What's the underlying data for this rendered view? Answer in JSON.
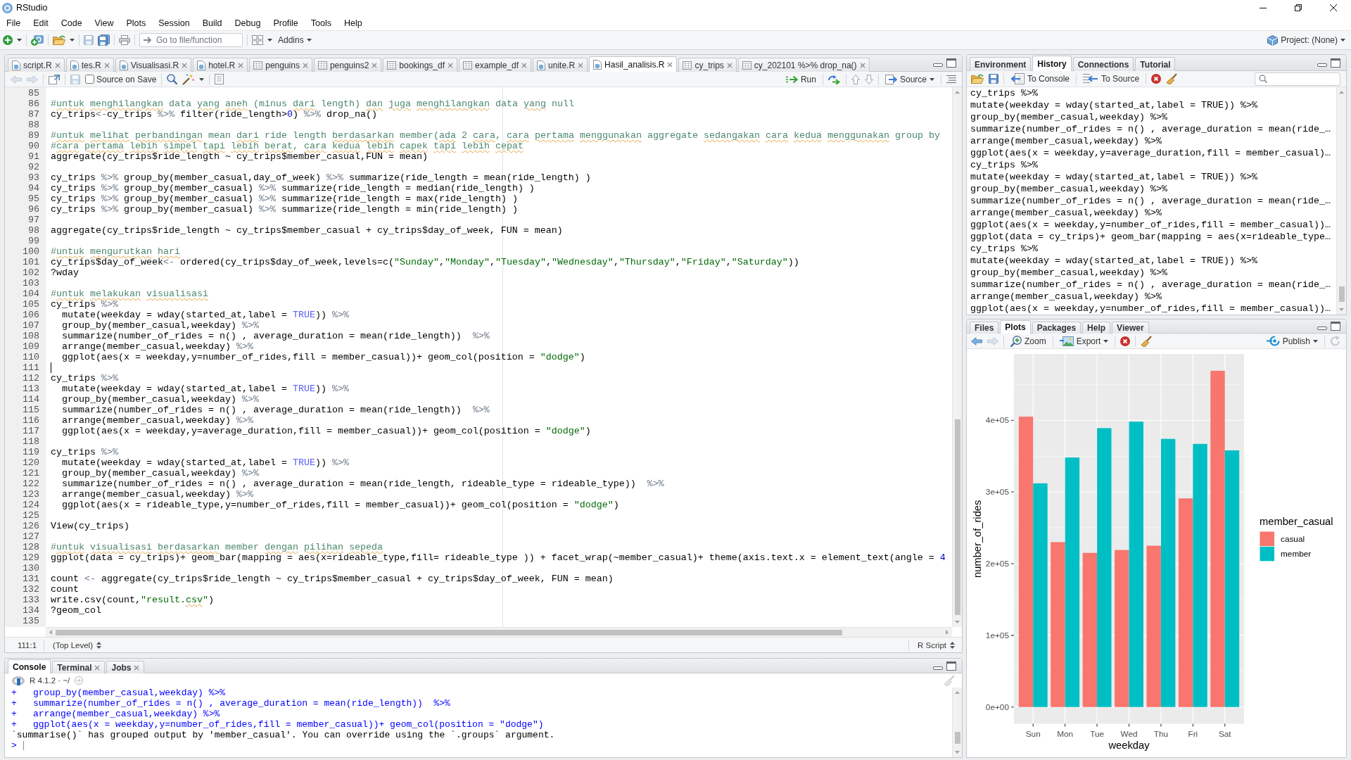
{
  "window": {
    "title": "RStudio"
  },
  "menu_bar": [
    "File",
    "Edit",
    "Code",
    "View",
    "Plots",
    "Session",
    "Build",
    "Debug",
    "Profile",
    "Tools",
    "Help"
  ],
  "toolbar": {
    "go_to_file": {
      "placeholder": "Go to file/function"
    },
    "addins": "Addins",
    "project": "Project: (None)"
  },
  "editor": {
    "tabs": [
      {
        "label": "script.R",
        "kind": "script",
        "selected": false,
        "closable": true
      },
      {
        "label": "tes.R",
        "kind": "script",
        "selected": false,
        "closable": true
      },
      {
        "label": "Visualisasi.R",
        "kind": "script",
        "selected": false,
        "closable": true
      },
      {
        "label": "hotel.R",
        "kind": "script",
        "selected": false,
        "closable": true
      },
      {
        "label": "penguins",
        "kind": "data",
        "selected": false,
        "closable": true
      },
      {
        "label": "penguins2",
        "kind": "data",
        "selected": false,
        "closable": true
      },
      {
        "label": "bookings_df",
        "kind": "data",
        "selected": false,
        "closable": true
      },
      {
        "label": "example_df",
        "kind": "data",
        "selected": false,
        "closable": true
      },
      {
        "label": "unite.R",
        "kind": "script",
        "selected": false,
        "closable": true
      },
      {
        "label": "Hasil_analisis.R",
        "kind": "script",
        "selected": true,
        "closable": true
      },
      {
        "label": "cy_trips",
        "kind": "data",
        "selected": false,
        "closable": true
      },
      {
        "label": "cy_202101 %>% drop_na()",
        "kind": "data",
        "selected": false,
        "closable": true
      }
    ],
    "toolbar": {
      "source_on_save": {
        "label": "Source on Save",
        "checked": false
      },
      "run": "Run",
      "source": "Source"
    },
    "lines": [
      {
        "number": "85",
        "cursor": false
      },
      {
        "number": "86",
        "cursor": false,
        "code": [
          {
            "kind": "comment",
            "text": "#"
          },
          {
            "kind": "misspelled",
            "text": "untuk"
          },
          {
            "kind": "misspelled",
            "text": " menghilangkan"
          },
          {
            "kind": "comment",
            "text": " data"
          },
          {
            "kind": "misspelled",
            "text": " yang"
          },
          {
            "kind": "misspelled",
            "text": " aneh"
          },
          {
            "kind": "comment",
            "text": " (minus"
          },
          {
            "kind": "misspelled",
            "text": " dari"
          },
          {
            "kind": "comment",
            "text": " length)"
          },
          {
            "kind": "misspelled",
            "text": " dan"
          },
          {
            "kind": "misspelled",
            "text": " juga"
          },
          {
            "kind": "misspelled",
            "text": " menghilangkan"
          },
          {
            "kind": "comment",
            "text": " data"
          },
          {
            "kind": "misspelled",
            "text": " yang"
          },
          {
            "kind": "comment",
            "text": " null"
          }
        ]
      },
      {
        "number": "87",
        "cursor": false,
        "code": [
          {
            "kind": "code",
            "text": "cy_trips"
          },
          {
            "kind": "operator",
            "text": "<-"
          },
          {
            "kind": "code",
            "text": "cy_trips "
          },
          {
            "kind": "operator",
            "text": "%>%"
          },
          {
            "kind": "code",
            "text": " filter(ride_length>"
          },
          {
            "kind": "number",
            "text": "0"
          },
          {
            "kind": "code",
            "text": ") "
          },
          {
            "kind": "operator",
            "text": "%>%"
          },
          {
            "kind": "code",
            "text": " drop_na()"
          }
        ]
      },
      {
        "number": "88",
        "cursor": false
      },
      {
        "number": "89",
        "cursor": false,
        "code": [
          {
            "kind": "comment",
            "text": "#"
          },
          {
            "kind": "misspelled",
            "text": "untuk"
          },
          {
            "kind": "misspelled",
            "text": " melihat"
          },
          {
            "kind": "misspelled",
            "text": " perbandingan"
          },
          {
            "kind": "comment",
            "text": " mean"
          },
          {
            "kind": "misspelled",
            "text": " dari"
          },
          {
            "kind": "comment",
            "text": " ride length"
          },
          {
            "kind": "misspelled",
            "text": " berdasarkan"
          },
          {
            "kind": "comment",
            "text": " member("
          },
          {
            "kind": "misspelled",
            "text": "ada"
          },
          {
            "kind": "comment",
            "text": " 2"
          },
          {
            "kind": "misspelled",
            "text": " cara"
          },
          {
            "kind": "comment",
            "text": ","
          },
          {
            "kind": "misspelled",
            "text": " cara"
          },
          {
            "kind": "misspelled",
            "text": " pertama"
          },
          {
            "kind": "misspelled",
            "text": " menggunakan"
          },
          {
            "kind": "comment",
            "text": " aggregate"
          },
          {
            "kind": "misspelled",
            "text": " sedangakan"
          },
          {
            "kind": "misspelled",
            "text": " cara"
          },
          {
            "kind": "misspelled",
            "text": " kedua"
          },
          {
            "kind": "misspelled",
            "text": " menggunakan"
          },
          {
            "kind": "comment",
            "text": " group by"
          }
        ]
      },
      {
        "number": "90",
        "cursor": false,
        "code": [
          {
            "kind": "comment",
            "text": "#"
          },
          {
            "kind": "misspelled",
            "text": "cara"
          },
          {
            "kind": "misspelled",
            "text": " pertama"
          },
          {
            "kind": "misspelled",
            "text": " lebih"
          },
          {
            "kind": "misspelled",
            "text": " simpel"
          },
          {
            "kind": "misspelled",
            "text": " tapi"
          },
          {
            "kind": "misspelled",
            "text": " lebih"
          },
          {
            "kind": "misspelled",
            "text": " berat"
          },
          {
            "kind": "comment",
            "text": ","
          },
          {
            "kind": "misspelled",
            "text": " cara"
          },
          {
            "kind": "misspelled",
            "text": " kedua"
          },
          {
            "kind": "misspelled",
            "text": " lebih"
          },
          {
            "kind": "misspelled",
            "text": " capek"
          },
          {
            "kind": "misspelled",
            "text": " tapi"
          },
          {
            "kind": "misspelled",
            "text": " lebih"
          },
          {
            "kind": "misspelled",
            "text": " cepat"
          }
        ]
      },
      {
        "number": "91",
        "cursor": false,
        "code": [
          {
            "kind": "code",
            "text": "aggregate(cy_trips$ride_length ~ cy_trips$member_casual,FUN = mean)"
          }
        ]
      },
      {
        "number": "92",
        "cursor": false
      },
      {
        "number": "93",
        "cursor": false,
        "code": [
          {
            "kind": "code",
            "text": "cy_trips "
          },
          {
            "kind": "operator",
            "text": "%>%"
          },
          {
            "kind": "code",
            "text": " group_by(member_casual,day_of_week) "
          },
          {
            "kind": "operator",
            "text": "%>%"
          },
          {
            "kind": "code",
            "text": " summarize(ride_length = mean(ride_length) )"
          }
        ]
      },
      {
        "number": "94",
        "cursor": false,
        "code": [
          {
            "kind": "code",
            "text": "cy_trips "
          },
          {
            "kind": "operator",
            "text": "%>%"
          },
          {
            "kind": "code",
            "text": " group_by(member_casual) "
          },
          {
            "kind": "operator",
            "text": "%>%"
          },
          {
            "kind": "code",
            "text": " summarize(ride_length = median(ride_length) )"
          }
        ]
      },
      {
        "number": "95",
        "cursor": false,
        "code": [
          {
            "kind": "code",
            "text": "cy_trips "
          },
          {
            "kind": "operator",
            "text": "%>%"
          },
          {
            "kind": "code",
            "text": " group_by(member_casual) "
          },
          {
            "kind": "operator",
            "text": "%>%"
          },
          {
            "kind": "code",
            "text": " summarize(ride_length = max(ride_length) )"
          }
        ]
      },
      {
        "number": "96",
        "cursor": false,
        "code": [
          {
            "kind": "code",
            "text": "cy_trips "
          },
          {
            "kind": "operator",
            "text": "%>%"
          },
          {
            "kind": "code",
            "text": " group_by(member_casual) "
          },
          {
            "kind": "operator",
            "text": "%>%"
          },
          {
            "kind": "code",
            "text": " summarize(ride_length = min(ride_length) )"
          }
        ]
      },
      {
        "number": "97",
        "cursor": false
      },
      {
        "number": "98",
        "cursor": false,
        "code": [
          {
            "kind": "code",
            "text": "aggregate(cy_trips$ride_length ~ cy_trips$member_casual + cy_trips$day_of_week, FUN = mean)"
          }
        ]
      },
      {
        "number": "99",
        "cursor": false
      },
      {
        "number": "100",
        "cursor": false,
        "code": [
          {
            "kind": "comment",
            "text": "#"
          },
          {
            "kind": "misspelled",
            "text": "untuk"
          },
          {
            "kind": "misspelled",
            "text": " mengurutkan"
          },
          {
            "kind": "misspelled",
            "text": " hari"
          }
        ]
      },
      {
        "number": "101",
        "cursor": false,
        "code": [
          {
            "kind": "code",
            "text": "cy_trips$day_of_week"
          },
          {
            "kind": "operator",
            "text": "<-"
          },
          {
            "kind": "code",
            "text": " ordered(cy_trips$day_of_week,levels=c("
          },
          {
            "kind": "string",
            "text": "\"Sunday\""
          },
          {
            "kind": "code",
            "text": ","
          },
          {
            "kind": "string",
            "text": "\"Monday\""
          },
          {
            "kind": "code",
            "text": ","
          },
          {
            "kind": "string",
            "text": "\"Tuesday\""
          },
          {
            "kind": "code",
            "text": ","
          },
          {
            "kind": "string",
            "text": "\"Wednesday\""
          },
          {
            "kind": "code",
            "text": ","
          },
          {
            "kind": "string",
            "text": "\"Thursday\""
          },
          {
            "kind": "code",
            "text": ","
          },
          {
            "kind": "string",
            "text": "\"Friday\""
          },
          {
            "kind": "code",
            "text": ","
          },
          {
            "kind": "string",
            "text": "\"Saturday\""
          },
          {
            "kind": "code",
            "text": "))"
          }
        ]
      },
      {
        "number": "102",
        "cursor": false,
        "code": [
          {
            "kind": "code",
            "text": "?wday"
          }
        ]
      },
      {
        "number": "103",
        "cursor": false
      },
      {
        "number": "104",
        "cursor": false,
        "code": [
          {
            "kind": "comment",
            "text": "#"
          },
          {
            "kind": "misspelled",
            "text": "untuk"
          },
          {
            "kind": "misspelled",
            "text": " melakukan"
          },
          {
            "kind": "misspelled",
            "text": " visualisasi"
          }
        ]
      },
      {
        "number": "105",
        "cursor": false,
        "code": [
          {
            "kind": "code",
            "text": "cy_trips "
          },
          {
            "kind": "operator",
            "text": "%>%"
          }
        ]
      },
      {
        "number": "106",
        "cursor": false,
        "code": [
          {
            "kind": "code",
            "text": "  mutate(weekday = wday(started_at,label = "
          },
          {
            "kind": "constant",
            "text": "TRUE"
          },
          {
            "kind": "code",
            "text": ")) "
          },
          {
            "kind": "operator",
            "text": "%>%"
          }
        ]
      },
      {
        "number": "107",
        "cursor": false,
        "code": [
          {
            "kind": "code",
            "text": "  group_by(member_casual,weekday) "
          },
          {
            "kind": "operator",
            "text": "%>%"
          }
        ]
      },
      {
        "number": "108",
        "cursor": false,
        "code": [
          {
            "kind": "code",
            "text": "  summarize(number_of_rides = n() , average_duration = mean(ride_length))  "
          },
          {
            "kind": "operator",
            "text": "%>%"
          }
        ]
      },
      {
        "number": "109",
        "cursor": false,
        "code": [
          {
            "kind": "code",
            "text": "  arrange(member_casual,weekday) "
          },
          {
            "kind": "operator",
            "text": "%>%"
          }
        ]
      },
      {
        "number": "110",
        "cursor": false,
        "code": [
          {
            "kind": "code",
            "text": "  ggplot(aes(x = weekday,y=number_of_rides,fill = member_casual))+ geom_col(position = "
          },
          {
            "kind": "string",
            "text": "\"dodge\""
          },
          {
            "kind": "code",
            "text": ")"
          }
        ]
      },
      {
        "number": "111",
        "cursor": true
      },
      {
        "number": "112",
        "cursor": false,
        "code": [
          {
            "kind": "code",
            "text": "cy_trips "
          },
          {
            "kind": "operator",
            "text": "%>%"
          }
        ]
      },
      {
        "number": "113",
        "cursor": false,
        "code": [
          {
            "kind": "code",
            "text": "  mutate(weekday = wday(started_at,label = "
          },
          {
            "kind": "constant",
            "text": "TRUE"
          },
          {
            "kind": "code",
            "text": ")) "
          },
          {
            "kind": "operator",
            "text": "%>%"
          }
        ]
      },
      {
        "number": "114",
        "cursor": false,
        "code": [
          {
            "kind": "code",
            "text": "  group_by(member_casual,weekday) "
          },
          {
            "kind": "operator",
            "text": "%>%"
          }
        ]
      },
      {
        "number": "115",
        "cursor": false,
        "code": [
          {
            "kind": "code",
            "text": "  summarize(number_of_rides = n() , average_duration = mean(ride_length))  "
          },
          {
            "kind": "operator",
            "text": "%>%"
          }
        ]
      },
      {
        "number": "116",
        "cursor": false,
        "code": [
          {
            "kind": "code",
            "text": "  arrange(member_casual,weekday) "
          },
          {
            "kind": "operator",
            "text": "%>%"
          }
        ]
      },
      {
        "number": "117",
        "cursor": false,
        "code": [
          {
            "kind": "code",
            "text": "  ggplot(aes(x = weekday,y=average_duration,fill = member_casual))+ geom_col(position = "
          },
          {
            "kind": "string",
            "text": "\"dodge\""
          },
          {
            "kind": "code",
            "text": ")"
          }
        ]
      },
      {
        "number": "118",
        "cursor": false
      },
      {
        "number": "119",
        "cursor": false,
        "code": [
          {
            "kind": "code",
            "text": "cy_trips "
          },
          {
            "kind": "operator",
            "text": "%>%"
          }
        ]
      },
      {
        "number": "120",
        "cursor": false,
        "code": [
          {
            "kind": "code",
            "text": "  mutate(weekday = wday(started_at,label = "
          },
          {
            "kind": "constant",
            "text": "TRUE"
          },
          {
            "kind": "code",
            "text": ")) "
          },
          {
            "kind": "operator",
            "text": "%>%"
          }
        ]
      },
      {
        "number": "121",
        "cursor": false,
        "code": [
          {
            "kind": "code",
            "text": "  group_by(member_casual,weekday) "
          },
          {
            "kind": "operator",
            "text": "%>%"
          }
        ]
      },
      {
        "number": "122",
        "cursor": false,
        "code": [
          {
            "kind": "code",
            "text": "  summarize(number_of_rides = n() , average_duration = mean(ride_length, rideable_type = rideable_type))  "
          },
          {
            "kind": "operator",
            "text": "%>%"
          }
        ]
      },
      {
        "number": "123",
        "cursor": false,
        "code": [
          {
            "kind": "code",
            "text": "  arrange(member_casual,weekday) "
          },
          {
            "kind": "operator",
            "text": "%>%"
          }
        ]
      },
      {
        "number": "124",
        "cursor": false,
        "code": [
          {
            "kind": "code",
            "text": "  ggplot(aes(x = rideable_type,y=number_of_rides,fill = member_casual))+ geom_col(position = "
          },
          {
            "kind": "string",
            "text": "\"dodge\""
          },
          {
            "kind": "code",
            "text": ")"
          }
        ]
      },
      {
        "number": "125",
        "cursor": false
      },
      {
        "number": "126",
        "cursor": false,
        "code": [
          {
            "kind": "code",
            "text": "View(cy_trips)"
          }
        ]
      },
      {
        "number": "127",
        "cursor": false
      },
      {
        "number": "128",
        "cursor": false,
        "code": [
          {
            "kind": "comment",
            "text": "#"
          },
          {
            "kind": "misspelled",
            "text": "untuk"
          },
          {
            "kind": "misspelled",
            "text": " visualisasi"
          },
          {
            "kind": "misspelled",
            "text": " berdasarkan"
          },
          {
            "kind": "comment",
            "text": " member"
          },
          {
            "kind": "misspelled",
            "text": " dengan"
          },
          {
            "kind": "misspelled",
            "text": " pilihan"
          },
          {
            "kind": "misspelled",
            "text": " sepeda"
          }
        ]
      },
      {
        "number": "129",
        "cursor": false,
        "code": [
          {
            "kind": "code",
            "text": "ggplot(data = cy_trips)+ geom_bar(mapping = aes(x=rideable_type,fill= rideable_type )) + facet_wrap(~member_casual)+ theme(axis.text.x = element_text(angle = "
          },
          {
            "kind": "number",
            "text": "4"
          }
        ]
      },
      {
        "number": "130",
        "cursor": false
      },
      {
        "number": "131",
        "cursor": false,
        "code": [
          {
            "kind": "code",
            "text": "count "
          },
          {
            "kind": "operator",
            "text": "<-"
          },
          {
            "kind": "code",
            "text": " aggregate(cy_trips$ride_length ~ cy_trips$member_casual + cy_trips$day_of_week, FUN = mean)"
          }
        ]
      },
      {
        "number": "132",
        "cursor": false,
        "code": [
          {
            "kind": "code",
            "text": "count"
          }
        ]
      },
      {
        "number": "133",
        "cursor": false,
        "code": [
          {
            "kind": "code",
            "text": "write.csv(count,"
          },
          {
            "kind": "string",
            "text": "\"result."
          },
          {
            "kind": "misspelled_string",
            "text": "csv"
          },
          {
            "kind": "string",
            "text": "\""
          },
          {
            "kind": "code",
            "text": ")"
          }
        ]
      },
      {
        "number": "134",
        "cursor": false,
        "code": [
          {
            "kind": "code",
            "text": "?geom_col"
          }
        ]
      },
      {
        "number": "135",
        "cursor": false
      }
    ],
    "status_bar": {
      "position": "111:1",
      "scope": "(Top Level)",
      "file_type": "R Script"
    }
  },
  "console": {
    "tabs": [
      {
        "label": "Console",
        "selected": true,
        "closable": false
      },
      {
        "label": "Terminal",
        "selected": false,
        "closable": true
      },
      {
        "label": "Jobs",
        "selected": false,
        "closable": true
      }
    ],
    "session": "R 4.1.2 · ~/",
    "lines": [
      {
        "kind": "input",
        "prompt": "+",
        "text": "group_by(member_casual,weekday) %>%",
        "cursor": false
      },
      {
        "kind": "input",
        "prompt": "+",
        "text": "summarize(number_of_rides = n() , average_duration = mean(ride_length))  %>%",
        "cursor": false
      },
      {
        "kind": "input",
        "prompt": "+",
        "text": "arrange(member_casual,weekday) %>%",
        "cursor": false
      },
      {
        "kind": "input",
        "prompt": "+",
        "text": "ggplot(aes(x = weekday,y=number_of_rides,fill = member_casual))+ geom_col(position = \"dodge\")",
        "cursor": false
      },
      {
        "kind": "output",
        "text": "`summarise()` has grouped output by 'member_casual'. You can override using the `.groups` argument.",
        "cursor": false
      },
      {
        "kind": "input",
        "prompt": ">",
        "cursor": true
      }
    ]
  },
  "environment_pane": {
    "tabs": [
      {
        "label": "Environment",
        "selected": false
      },
      {
        "label": "History",
        "selected": true
      },
      {
        "label": "Connections",
        "selected": false
      },
      {
        "label": "Tutorial",
        "selected": false
      }
    ],
    "toolbar": {
      "to_console": "To Console",
      "to_source": "To Source"
    },
    "history": [
      "cy_trips %>%",
      "mutate(weekday = wday(started_at,label = TRUE)) %>%",
      "group_by(member_casual,weekday) %>%",
      "summarize(number_of_rides = n() , average_duration = mean(ride_…",
      "arrange(member_casual,weekday) %>%",
      "ggplot(aes(x = weekday,y=average_duration,fill = member_casual)…",
      "cy_trips %>%",
      "mutate(weekday = wday(started_at,label = TRUE)) %>%",
      "group_by(member_casual,weekday) %>%",
      "summarize(number_of_rides = n() , average_duration = mean(ride_…",
      "arrange(member_casual,weekday) %>%",
      "ggplot(aes(x = weekday,y=number_of_rides,fill = member_casual))…",
      "ggplot(data = cy_trips)+ geom_bar(mapping = aes(x=rideable_type…",
      "cy_trips %>%",
      "mutate(weekday = wday(started_at,label = TRUE)) %>%",
      "group_by(member_casual,weekday) %>%",
      "summarize(number_of_rides = n() , average_duration = mean(ride_…",
      "arrange(member_casual,weekday) %>%",
      "ggplot(aes(x = weekday,y=number_of_rides,fill = member_casual))…"
    ]
  },
  "plots_pane": {
    "tabs": [
      {
        "label": "Files",
        "selected": false
      },
      {
        "label": "Plots",
        "selected": true
      },
      {
        "label": "Packages",
        "selected": false
      },
      {
        "label": "Help",
        "selected": false
      },
      {
        "label": "Viewer",
        "selected": false
      }
    ],
    "toolbar": {
      "zoom": "Zoom",
      "export": "Export",
      "publish": "Publish"
    },
    "chart_data": {
      "type": "bar",
      "xlabel": "weekday",
      "ylabel": "number_of_rides",
      "legend_title": "member_casual",
      "categories": [
        "Sun",
        "Mon",
        "Tue",
        "Wed",
        "Thu",
        "Fri",
        "Sat"
      ],
      "series": [
        {
          "name": "casual",
          "color": "#f8766d",
          "values": [
            405000,
            230000,
            215000,
            219000,
            225000,
            291000,
            469000
          ]
        },
        {
          "name": "member",
          "color": "#00bfc4",
          "values": [
            312000,
            348000,
            389000,
            398000,
            374000,
            367000,
            358000
          ]
        }
      ],
      "yticks": [
        {
          "value": 0,
          "label": "0e+00"
        },
        {
          "value": 100000,
          "label": "1e+05"
        },
        {
          "value": 200000,
          "label": "2e+05"
        },
        {
          "value": 300000,
          "label": "3e+05"
        },
        {
          "value": 400000,
          "label": "4e+05"
        }
      ],
      "ylim": [
        -23450,
        492450
      ],
      "grid": true,
      "legend": "right"
    }
  }
}
